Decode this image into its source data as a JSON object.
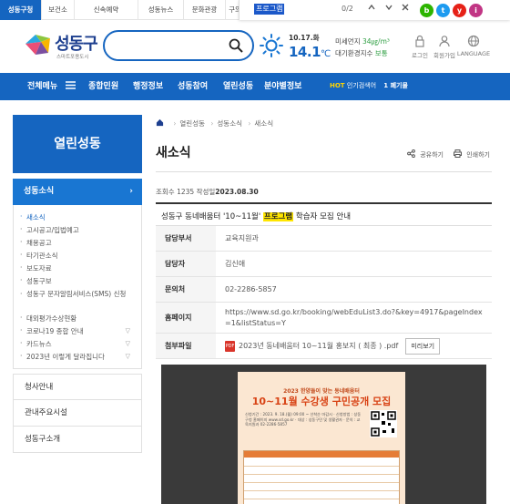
{
  "topbar": {
    "tabs": [
      "성동구청",
      "보건소",
      "신속예약",
      "성동뉴스",
      "문화관광",
      "구의"
    ],
    "find": {
      "query": "프로그램",
      "count": "0/2"
    },
    "social": [
      "b",
      "t",
      "y",
      "i"
    ]
  },
  "header": {
    "logo": "성동구",
    "logo_sub": "스마트포용도시",
    "search_placeholder": "",
    "weather": {
      "date": "10.17.화",
      "temp": "14.1",
      "unit": "℃"
    },
    "air": {
      "dust_label": "미세먼지",
      "dust_value": "34㎍/m³",
      "index_label": "대기환경지수",
      "index_value": "보통"
    },
    "util": [
      "로그인",
      "회원가입",
      "LANGUAGE"
    ]
  },
  "nav": {
    "all_menu": "전체메뉴",
    "items": [
      "종합민원",
      "행정정보",
      "성동참여",
      "열린성동",
      "분야별정보"
    ],
    "hot_label": "HOT",
    "hot_text": "인기검색어",
    "rank": "1 폐기물"
  },
  "sidebar": {
    "title": "열린성동",
    "active": "성동소식",
    "sub_items": [
      "새소식",
      "고시공고/입법예고",
      "채용공고",
      "타기관소식",
      "보도자료",
      "성동구보",
      "성동구 문자알림서비스(SMS) 신청",
      "대외평가수상현황",
      "코로나19 종합 안내",
      "카드뉴스",
      "2023년 이렇게 달라집니다"
    ],
    "menus": [
      "청사안내",
      "관내주요시설",
      "성동구소개"
    ]
  },
  "content": {
    "breadcrumb": [
      "열린성동",
      "성동소식",
      "새소식"
    ],
    "title": "새소식",
    "share": "공유하기",
    "print": "인쇄하기",
    "meta": {
      "views_label": "조회수",
      "views": "1235",
      "date_label": "작성일",
      "date": "2023.08.30"
    },
    "post_title_pre": "성동구 동네배움터 '10~11월' ",
    "post_title_hl": "프로그램",
    "post_title_post": " 학습자 모집 안내",
    "rows": {
      "dept_label": "담당부서",
      "dept": "교육지원과",
      "person_label": "담당자",
      "person": "김신애",
      "phone_label": "문의처",
      "phone": "02-2286-5857",
      "homepage_label": "홈페이지",
      "homepage": "https://www.sd.go.kr/booking/webEduList3.do?&key=4917&pageIndex=1&listStatus=Y",
      "file_label": "첨부파일",
      "file": "2023년 동네배움터 10~11월 홍보지 ( 최종 ) .pdf",
      "preview": "미리보기"
    },
    "poster": {
      "line1": "2023 한양들이 맞는 동네배움터",
      "line2": "10~11월 수강생 구민공개 모집",
      "body": "신청기간 : 2023. 9. 18.(월) 09:00 ~ 선착순 마감시 · 신청방법 : 성동구청 홈페이지 www.sd.go.kr · 대상 : 성동구민 및 생활권자 · 문의 : 교육지원과 02-2286-5857"
    }
  }
}
